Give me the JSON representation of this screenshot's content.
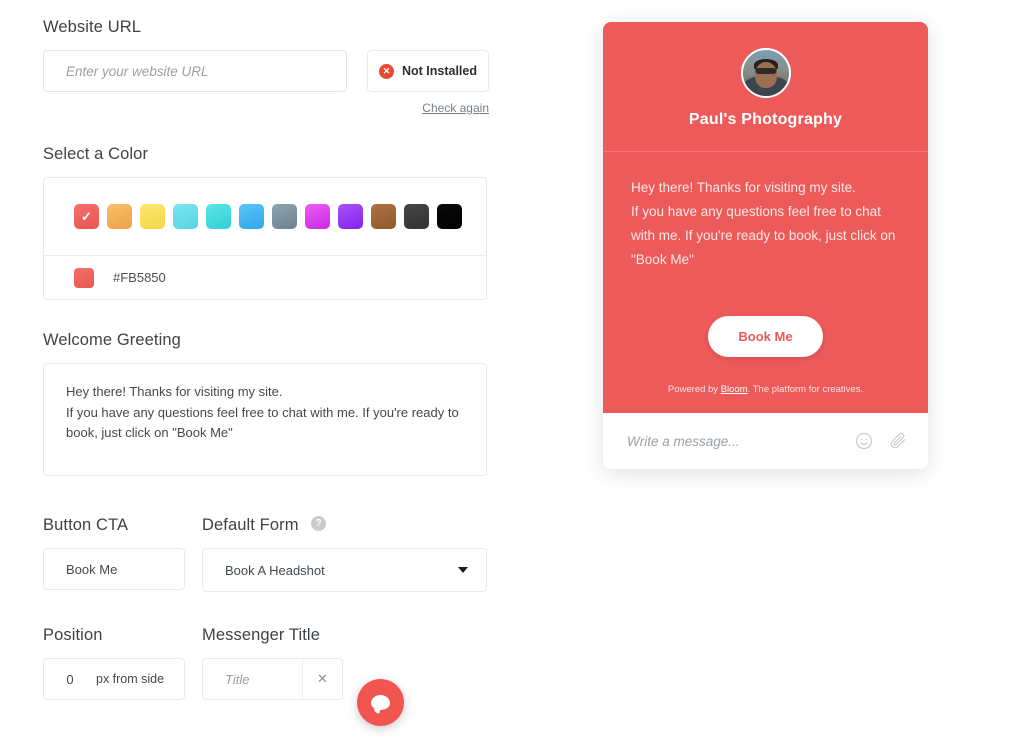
{
  "form": {
    "website_url": {
      "label": "Website URL",
      "placeholder": "Enter your website URL",
      "value": "",
      "status_label": "Not Installed",
      "status_icon": "error-circle-icon",
      "status_color": "#e8492f",
      "check_again_label": "Check again"
    },
    "color": {
      "label": "Select a Color",
      "selected_hex": "#FB5850",
      "selected_index": 0,
      "swatches": [
        {
          "name": "coral-red",
          "hex": "#F0615B",
          "gradient": "linear-gradient(160deg,#f4716a 0%,#e8554f 100%)",
          "selected": true
        },
        {
          "name": "orange-amber",
          "hex": "#F3A94C",
          "gradient": "linear-gradient(160deg,#f8c06a 0%,#efa043 100%)",
          "selected": false
        },
        {
          "name": "yellow",
          "hex": "#F8DB52",
          "gradient": "linear-gradient(160deg,#fbe873 0%,#f6d644 100%)",
          "selected": false
        },
        {
          "name": "light-cyan",
          "hex": "#64DCEA",
          "gradient": "linear-gradient(160deg,#7ce6f0 0%,#57d3e4 100%)",
          "selected": false
        },
        {
          "name": "turquoise",
          "hex": "#3FD9DE",
          "gradient": "linear-gradient(160deg,#5ce6e8 0%,#33cdd4 100%)",
          "selected": false
        },
        {
          "name": "sky-blue",
          "hex": "#3CB5F0",
          "gradient": "linear-gradient(160deg,#59c6f5 0%,#2fa6eb 100%)",
          "selected": false
        },
        {
          "name": "slate-gray",
          "hex": "#7A909E",
          "gradient": "linear-gradient(160deg,#8ea4b0 0%,#6b828f 100%)",
          "selected": false
        },
        {
          "name": "magenta",
          "hex": "#D83CEA",
          "gradient": "linear-gradient(160deg,#e85ef5 0%,#cc2ae0 100%)",
          "selected": false
        },
        {
          "name": "purple",
          "hex": "#9335F2",
          "gradient": "linear-gradient(160deg,#a652f8 0%,#8423ec 100%)",
          "selected": false
        },
        {
          "name": "brown",
          "hex": "#9E6534",
          "gradient": "linear-gradient(160deg,#ac7340 0%,#915a2c 100%)",
          "selected": false
        },
        {
          "name": "dark-gray",
          "hex": "#3A3A3A",
          "gradient": "linear-gradient(160deg,#454545 0%,#333333 100%)",
          "selected": false
        },
        {
          "name": "black",
          "hex": "#000000",
          "gradient": "linear-gradient(160deg,#0a0a0a 0%,#000000 100%)",
          "selected": false
        }
      ]
    },
    "greeting": {
      "label": "Welcome Greeting",
      "value": "Hey there! Thanks for visiting my site.\nIf you have any questions feel free to chat with me. If you're ready to book, just click on \"Book Me\""
    },
    "button_cta": {
      "label": "Button CTA",
      "value": "Book Me"
    },
    "default_form": {
      "label": "Default Form",
      "help_icon": "question-mark-icon",
      "selected": "Book A Headshot",
      "options": [
        "Book A Headshot"
      ]
    },
    "position": {
      "label": "Position",
      "value": "0",
      "unit": "px from side"
    },
    "messenger_title": {
      "label": "Messenger Title",
      "placeholder": "Title",
      "value": "",
      "clear_icon": "close-icon"
    }
  },
  "launcher": {
    "icon": "chat-bubble-icon",
    "color": "#F0554F"
  },
  "widget": {
    "header": {
      "avatar_alt": "avatar",
      "title": "Paul's Photography",
      "background": "#EC5A5A"
    },
    "message": "Hey there! Thanks for visiting my site.\nIf you have any questions feel free to chat with me. If you're ready to book, just click on \"Book Me\"",
    "cta_label": "Book Me",
    "powered_by": {
      "prefix": "Powered by ",
      "brand": "Bloom",
      "suffix": ". The platform for creatives."
    },
    "input": {
      "placeholder": "Write a message...",
      "emoji_icon": "smiley-icon",
      "attach_icon": "paperclip-icon"
    }
  }
}
